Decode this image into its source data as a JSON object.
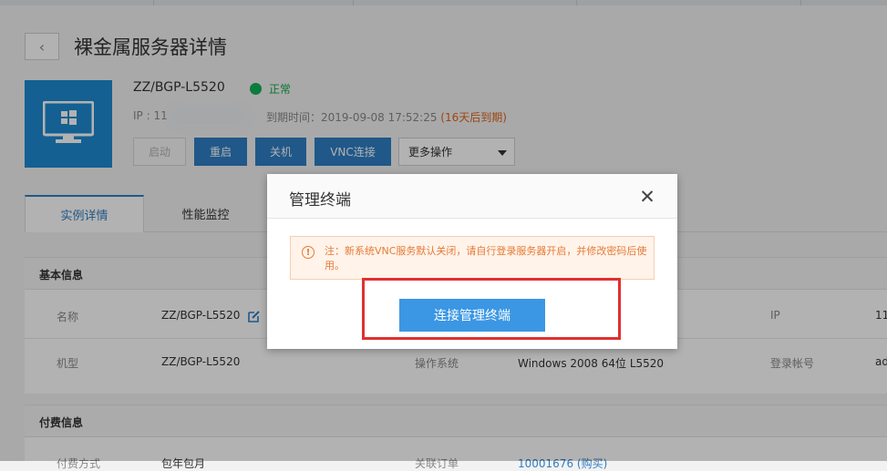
{
  "header": {
    "back_icon": "chevron-left-icon",
    "title": "裸金属服务器详情"
  },
  "server": {
    "icon": "monitor-windows-icon",
    "name": "ZZ/BGP-L5520",
    "status": "正常",
    "status_color": "#12b05a",
    "ip_label": "IP :",
    "ip_value": "11",
    "expire_label": "到期时间：",
    "expire_value": "2019-09-08 17:52:25",
    "expire_note": "(16天后到期)"
  },
  "actions": {
    "start": "启动",
    "restart": "重启",
    "shutdown": "关机",
    "vnc": "VNC连接",
    "more": "更多操作"
  },
  "tabs": [
    "实例详情",
    "性能监控"
  ],
  "basic": {
    "heading": "基本信息",
    "rows": [
      {
        "label": "名称",
        "value": "ZZ/BGP-L5520",
        "label2": "",
        "value2": "",
        "label3": "IP",
        "value3": "11"
      },
      {
        "label": "机型",
        "value": "ZZ/BGP-L5520",
        "label2": "操作系统",
        "value2": "Windows 2008 64位 L5520",
        "label3": "登录帐号",
        "value3": "ad"
      }
    ]
  },
  "billing": {
    "heading": "付费信息",
    "row": {
      "label": "付费方式",
      "value": "包年包月",
      "label2": "关联订单",
      "value2": "10001676 (购买)"
    }
  },
  "dialog": {
    "title": "管理终端",
    "close_icon": "close-icon",
    "notice_icon": "warning-icon",
    "notice": "注：新系统VNC服务默认关闭，请自行登录服务器开启，并修改密码后使用。",
    "connect": "连接管理终端"
  },
  "colors": {
    "accent": "#2f7ec4",
    "warning": "#e57b35",
    "highlight": "#e03030"
  }
}
